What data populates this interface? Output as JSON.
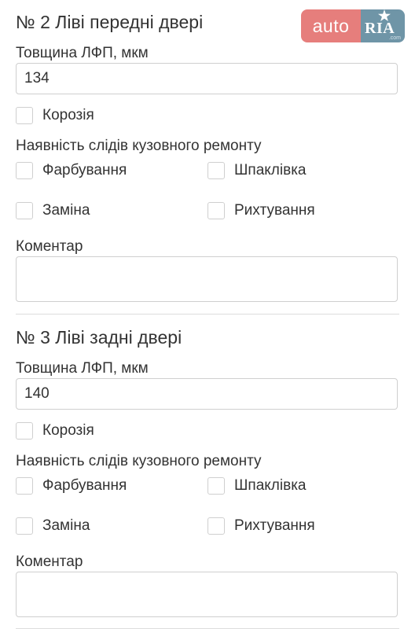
{
  "logo": {
    "left_text": "auto",
    "right_text": "RIA",
    "suffix": ".com",
    "left_color": "#e67e7c",
    "right_color": "#6f95a7"
  },
  "sections": [
    {
      "title": "№ 2 Ліві передні двері",
      "thickness_label": "Товщина ЛФП, мкм",
      "thickness_value": "134",
      "corrosion_label": "Корозія",
      "corrosion_checked": false,
      "repair_label": "Наявність слідів кузовного ремонту",
      "options": {
        "paint": "Фарбування",
        "putty": "Шпаклівка",
        "replace": "Заміна",
        "straighten": "Рихтування"
      },
      "comment_label": "Коментар",
      "comment_value": ""
    },
    {
      "title": "№ 3 Ліві задні двері",
      "thickness_label": "Товщина ЛФП, мкм",
      "thickness_value": "140",
      "corrosion_label": "Корозія",
      "corrosion_checked": false,
      "repair_label": "Наявність слідів кузовного ремонту",
      "options": {
        "paint": "Фарбування",
        "putty": "Шпаклівка",
        "replace": "Заміна",
        "straighten": "Рихтування"
      },
      "comment_label": "Коментар",
      "comment_value": ""
    }
  ]
}
